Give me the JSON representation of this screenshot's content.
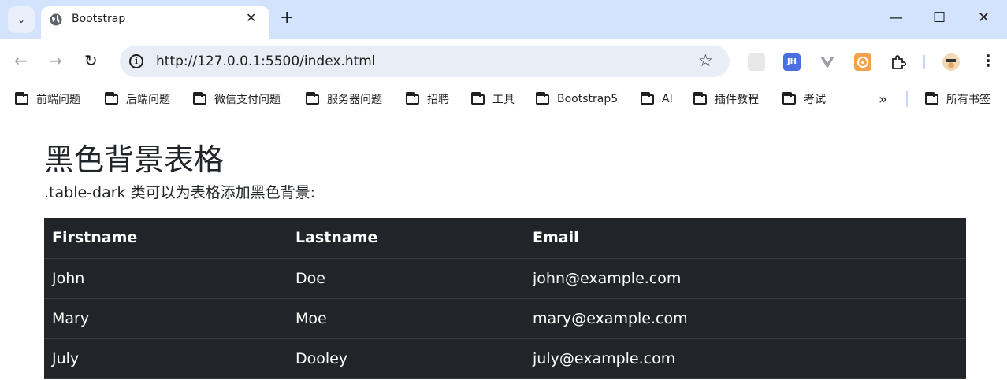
{
  "browser": {
    "tab_title": "Bootstrap",
    "tab_close": "✕",
    "new_tab": "+",
    "url": "http://127.0.0.1:5500/index.html",
    "window_controls": {
      "minimize": "—",
      "maximize": "☐",
      "close": "✕"
    }
  },
  "bookmarks": {
    "items": [
      "前端问题",
      "后端问题",
      "微信支付问题",
      "服务器问题",
      "招聘",
      "工具",
      "Bootstrap5",
      "AI",
      "插件教程",
      "考试"
    ],
    "overflow": "»",
    "all_bookmarks": "所有书签"
  },
  "page": {
    "heading": "黑色背景表格",
    "description": ".table-dark 类可以为表格添加黑色背景:",
    "table": {
      "headers": [
        "Firstname",
        "Lastname",
        "Email"
      ],
      "rows": [
        [
          "John",
          "Doe",
          "john@example.com"
        ],
        [
          "Mary",
          "Moe",
          "mary@example.com"
        ],
        [
          "July",
          "Dooley",
          "july@example.com"
        ]
      ]
    }
  },
  "icons": {
    "back": "arrow-left-icon",
    "forward": "arrow-right-icon",
    "reload": "reload-icon",
    "info": "info-icon",
    "bookmark_star": "star-icon",
    "extensions": "puzzle-icon",
    "menu": "more-vertical-icon"
  },
  "colors": {
    "titlebar": "#d3e3fd",
    "omnibox": "#e9eef6",
    "table_bg": "#212529",
    "text": "#212529"
  }
}
